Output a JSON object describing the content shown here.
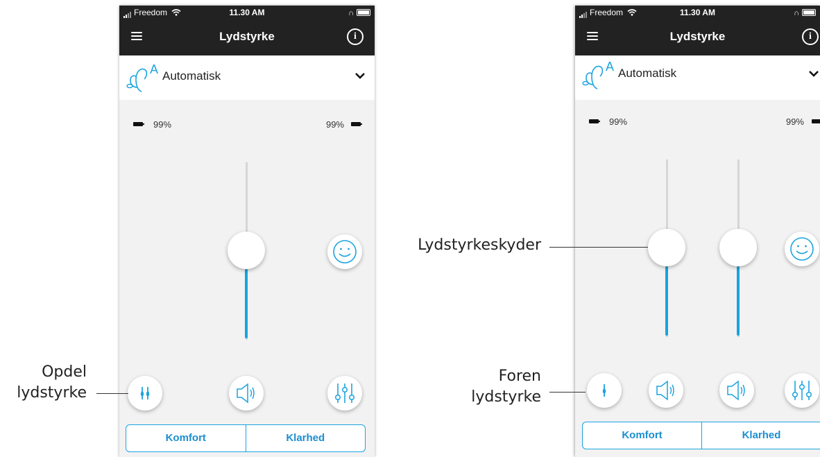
{
  "left_screen": {
    "status": {
      "carrier": "Freedom",
      "time": "11.30 AM"
    },
    "nav": {
      "title": "Lydstyrke"
    },
    "program": {
      "name": "Automatisk",
      "icon_letter": "A"
    },
    "battery": {
      "left_percent": "99%",
      "right_percent": "99%"
    },
    "sliders": [
      {
        "level": 0.42
      }
    ],
    "buttons": [
      "split-volume-icon",
      "speaker-icon",
      "equalizer-icon"
    ],
    "smiley_icon": "smiley-icon",
    "segments": [
      "Komfort",
      "Klarhed"
    ]
  },
  "right_screen": {
    "status": {
      "carrier": "Freedom",
      "time": "11.30 AM"
    },
    "nav": {
      "title": "Lydstyrke"
    },
    "program": {
      "name": "Automatisk",
      "icon_letter": "A"
    },
    "battery": {
      "left_percent": "99%",
      "right_percent": "99%"
    },
    "sliders": [
      {
        "level": 0.42
      },
      {
        "level": 0.42
      }
    ],
    "buttons": [
      "join-volume-icon",
      "speaker-icon",
      "speaker-icon",
      "equalizer-icon"
    ],
    "smiley_icon": "smiley-icon",
    "segments": [
      "Komfort",
      "Klarhed"
    ]
  },
  "callouts": {
    "split_line1": "Opdel",
    "split_line2": "lydstyrke",
    "slider_label": "Lydstyrkeskyder",
    "join_line1": "Foren",
    "join_line2": "lydstyrke"
  },
  "colors": {
    "accent": "#1aa3df",
    "header": "#222222",
    "background": "#f2f2f2"
  }
}
